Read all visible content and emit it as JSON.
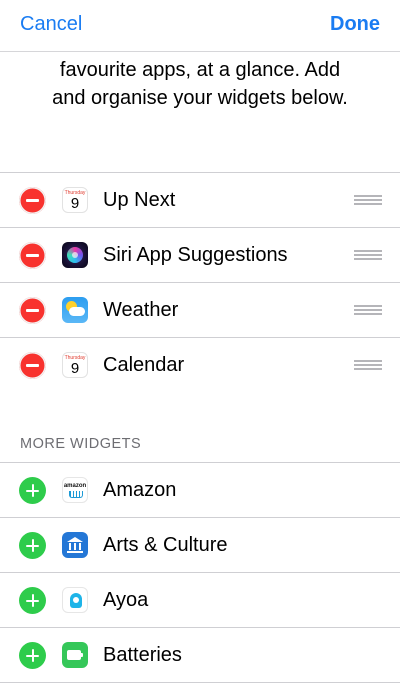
{
  "nav": {
    "cancel_label": "Cancel",
    "done_label": "Done"
  },
  "intro": {
    "line1": "favourite apps, at a glance. Add",
    "line2": "and organise your widgets below."
  },
  "active_widgets": [
    {
      "label": "Up Next",
      "icon": "calendar-icon",
      "calendar_day": "Thursday",
      "calendar_date": "9"
    },
    {
      "label": "Siri App Suggestions",
      "icon": "siri-icon"
    },
    {
      "label": "Weather",
      "icon": "weather-icon"
    },
    {
      "label": "Calendar",
      "icon": "calendar-icon",
      "calendar_day": "Thursday",
      "calendar_date": "9"
    }
  ],
  "more_widgets": {
    "header": "MORE WIDGETS",
    "items": [
      {
        "label": "Amazon",
        "icon": "amazon-icon",
        "icon_text": "amazon"
      },
      {
        "label": "Arts & Culture",
        "icon": "arts-culture-icon"
      },
      {
        "label": "Ayoa",
        "icon": "ayoa-icon"
      },
      {
        "label": "Batteries",
        "icon": "batteries-icon"
      }
    ]
  },
  "colors": {
    "accent": "#1a7cf2",
    "remove": "#f8322e",
    "add": "#2ecc4b",
    "separator": "#cfcfd3",
    "section_header": "#6d6d72"
  }
}
